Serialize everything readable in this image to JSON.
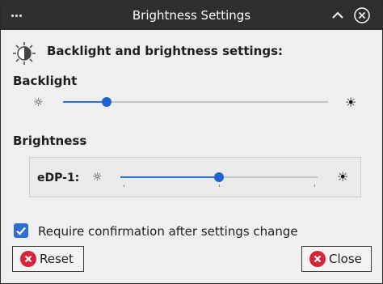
{
  "window": {
    "title": "Brightness Settings",
    "menu_icon": "more-dots-icon",
    "shade_icon": "chevron-up-icon",
    "close_icon": "close-icon"
  },
  "header": {
    "icon": "brightness-contrast-icon",
    "text": "Backlight and brightness settings:"
  },
  "backlight": {
    "title": "Backlight",
    "low_icon": "☼",
    "high_icon": "☀",
    "level": 0.165
  },
  "brightness": {
    "title": "Brightness",
    "outputs": [
      {
        "label": "eDP-1:",
        "low_icon": "☼",
        "high_icon": "☀",
        "level": 0.5
      }
    ]
  },
  "options": {
    "require_confirmation": {
      "label": "Require confirmation after settings change",
      "checked": true
    }
  },
  "buttons": {
    "reset": {
      "label": "Reset",
      "icon": "cancel-icon"
    },
    "close": {
      "label": "Close",
      "icon": "cancel-icon"
    }
  },
  "colors": {
    "accent": "#2d6fd1",
    "titlebar": "#2f2f2f",
    "cancel_icon": "#d6243a"
  }
}
